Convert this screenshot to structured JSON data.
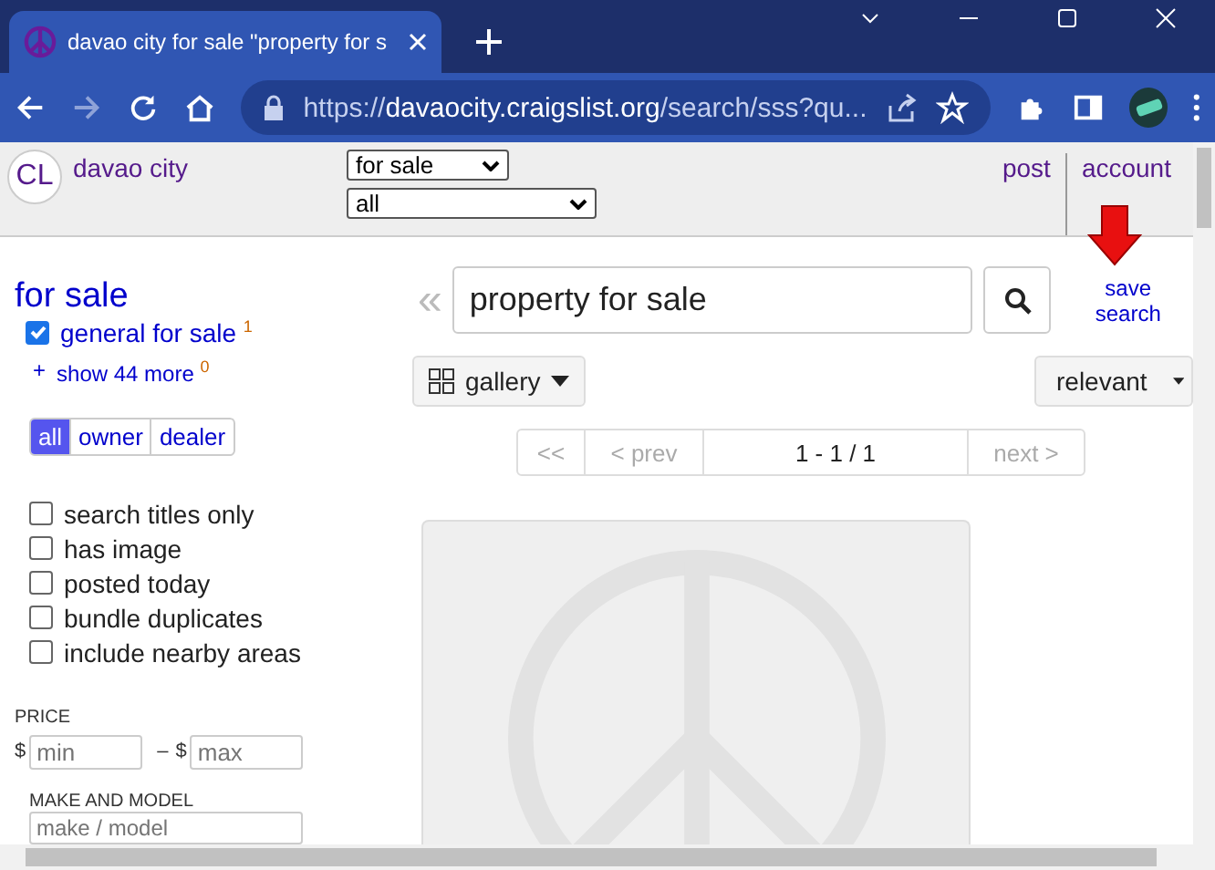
{
  "browser": {
    "tab": {
      "title": "davao city for sale \"property for s"
    },
    "address": {
      "scheme": "https://",
      "domain": "davaocity.craigslist.org",
      "path": "/search/sss?qu..."
    }
  },
  "header": {
    "logo": "CL",
    "city": "davao city",
    "category_select": "for sale",
    "subcategory_select": "all",
    "links": [
      "post",
      "account"
    ]
  },
  "sidebar": {
    "heading": "for sale",
    "categories": [
      {
        "label": "general for sale",
        "count": "1",
        "checked": true
      }
    ],
    "show_more": {
      "icon": "+",
      "label": "show 44 more",
      "count": "0"
    },
    "seller_types": [
      {
        "label": "all",
        "selected": true
      },
      {
        "label": "owner",
        "selected": false
      },
      {
        "label": "dealer",
        "selected": false
      }
    ],
    "filters": [
      {
        "label": "search titles only",
        "checked": false
      },
      {
        "label": "has image",
        "checked": false
      },
      {
        "label": "posted today",
        "checked": false
      },
      {
        "label": "bundle duplicates",
        "checked": false
      },
      {
        "label": "include nearby areas",
        "checked": false
      }
    ],
    "price": {
      "label": "PRICE",
      "min_currency": "$",
      "min_placeholder": "min",
      "separator": "–",
      "max_currency": "$",
      "max_placeholder": "max"
    },
    "make_model": {
      "label": "MAKE AND MODEL",
      "placeholder": "make / model"
    }
  },
  "search": {
    "back": "«",
    "query": "property for sale",
    "save_search": "save search"
  },
  "view_select": "gallery",
  "sort_select": "relevant",
  "pagination": {
    "first": "<<",
    "prev": "< prev",
    "range": "1 - 1 / 1",
    "next": "next >"
  },
  "results": [
    {
      "kind": "placeholder"
    }
  ]
}
